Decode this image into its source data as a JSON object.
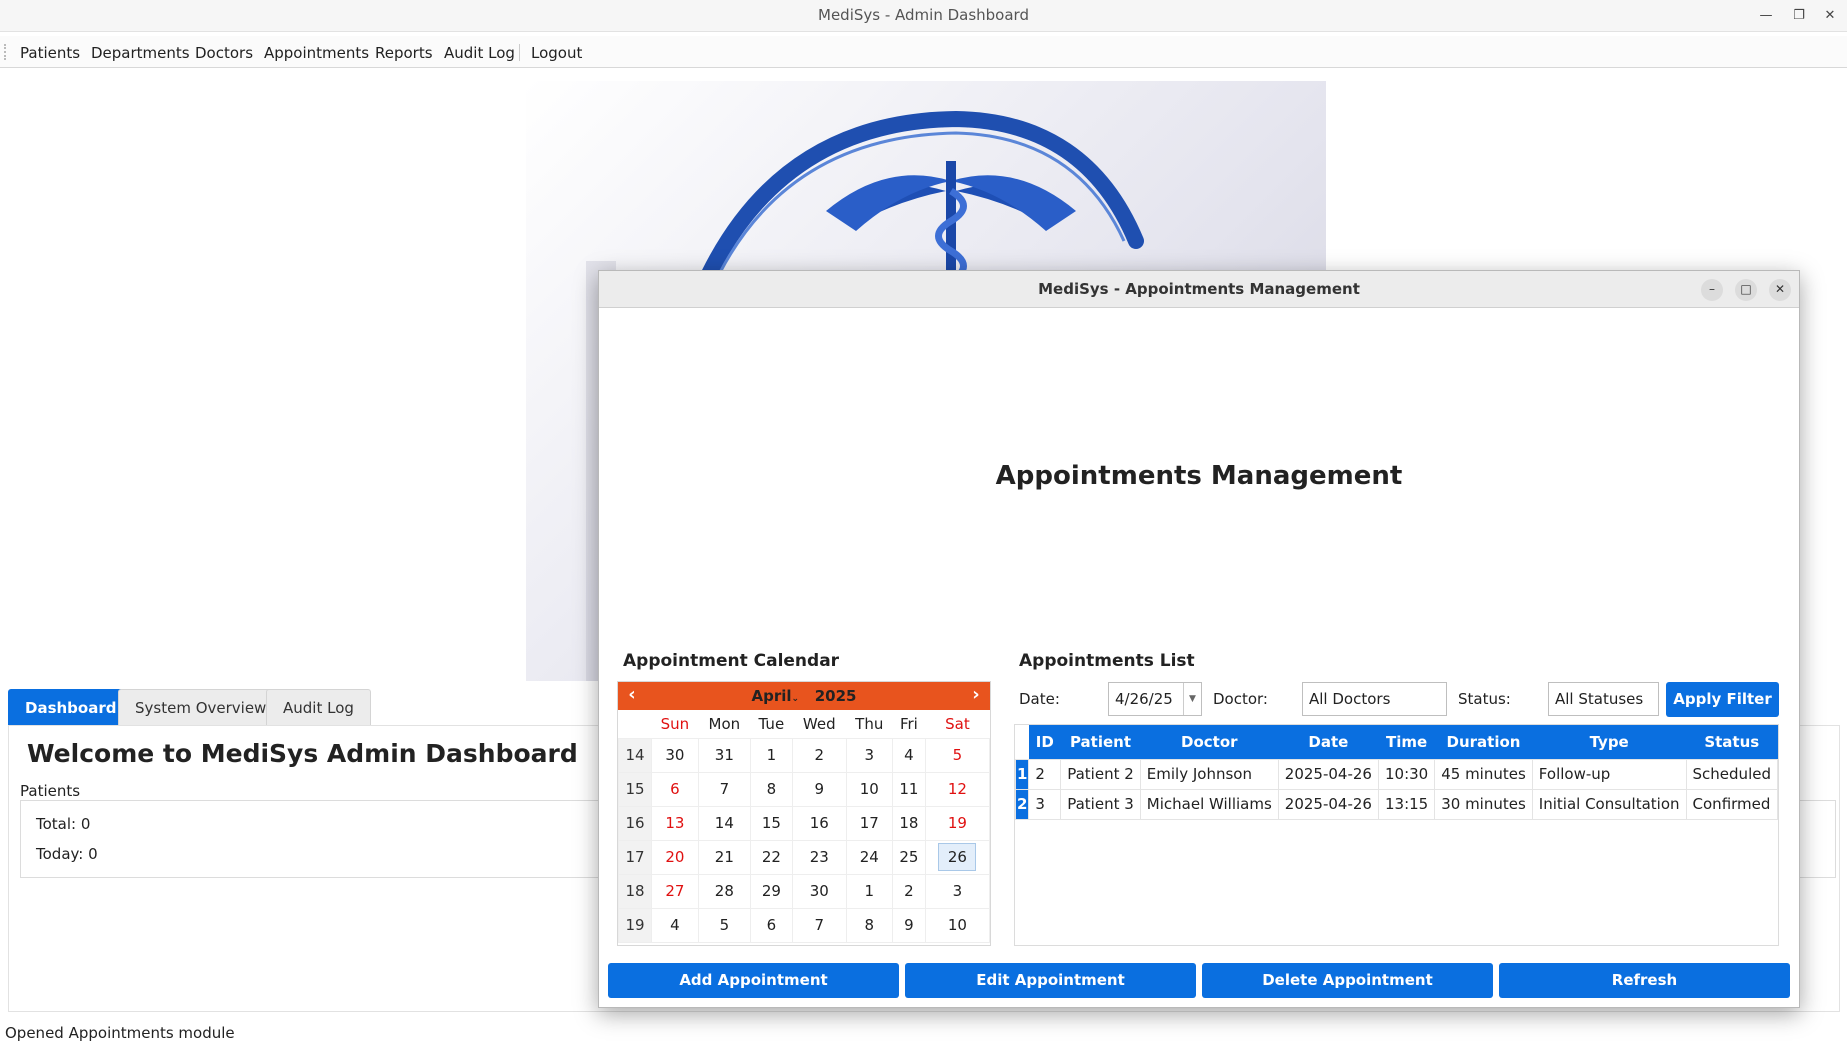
{
  "window": {
    "title": "MediSys - Admin Dashboard"
  },
  "menu": [
    "Patients",
    "Departments",
    "Doctors",
    "Appointments",
    "Reports",
    "Audit Log",
    "Logout"
  ],
  "tabs": [
    "Dashboard",
    "System Overview",
    "Audit Log"
  ],
  "dashboard": {
    "welcome": "Welcome to MediSys Admin Dashboard",
    "patients_label": "Patients",
    "total": "Total: 0",
    "today": "Today: 0"
  },
  "status_bar": "Opened Appointments module",
  "dialog": {
    "title": "MediSys - Appointments Management",
    "heading": "Appointments Management",
    "calendar_title": "Appointment Calendar",
    "list_title": "Appointments List",
    "calendar": {
      "month": "April",
      "year": "2025",
      "weekdays": [
        "Sun",
        "Mon",
        "Tue",
        "Wed",
        "Thu",
        "Fri",
        "Sat"
      ],
      "weeks": [
        {
          "wk": "14",
          "days": [
            "30",
            "31",
            "1",
            "2",
            "3",
            "4",
            "5"
          ]
        },
        {
          "wk": "15",
          "days": [
            "6",
            "7",
            "8",
            "9",
            "10",
            "11",
            "12"
          ]
        },
        {
          "wk": "16",
          "days": [
            "13",
            "14",
            "15",
            "16",
            "17",
            "18",
            "19"
          ]
        },
        {
          "wk": "17",
          "days": [
            "20",
            "21",
            "22",
            "23",
            "24",
            "25",
            "26"
          ]
        },
        {
          "wk": "18",
          "days": [
            "27",
            "28",
            "29",
            "30",
            "1",
            "2",
            "3"
          ]
        },
        {
          "wk": "19",
          "days": [
            "4",
            "5",
            "6",
            "7",
            "8",
            "9",
            "10"
          ]
        }
      ],
      "selected": "26"
    },
    "filters": {
      "date_label": "Date:",
      "date_value": "4/26/25",
      "doctor_label": "Doctor:",
      "doctor_value": "All Doctors",
      "status_label": "Status:",
      "status_value": "All Statuses",
      "apply": "Apply Filter"
    },
    "table": {
      "columns": [
        "ID",
        "Patient",
        "Doctor",
        "Date",
        "Time",
        "Duration",
        "Type",
        "Status"
      ],
      "rows": [
        {
          "n": "1",
          "cells": [
            "2",
            "Patient 2",
            "Emily Johnson",
            "2025-04-26",
            "10:30",
            "45 minutes",
            "Follow-up",
            "Scheduled"
          ]
        },
        {
          "n": "2",
          "cells": [
            "3",
            "Patient 3",
            "Michael Williams",
            "2025-04-26",
            "13:15",
            "30 minutes",
            "Initial Consultation",
            "Confirmed"
          ]
        }
      ]
    },
    "buttons": [
      "Add Appointment",
      "Edit Appointment",
      "Delete Appointment",
      "Refresh"
    ]
  },
  "colors": {
    "accent": "#0a6fe0",
    "calendar_header": "#e8541e",
    "weekend": "#e01010"
  }
}
